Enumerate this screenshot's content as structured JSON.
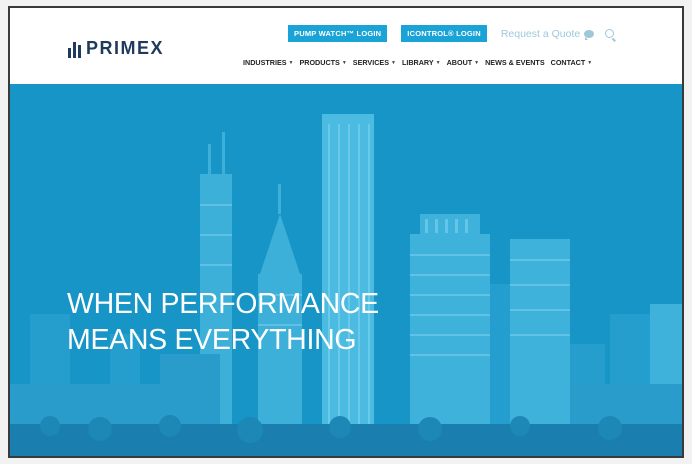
{
  "brand": {
    "name": "PRIMEX"
  },
  "header": {
    "pump_watch_login": "PUMP WATCH™ LOGIN",
    "icontrol_login": "ICONTROL® LOGIN",
    "request_quote": "Request a Quote",
    "nav": [
      {
        "label": "INDUSTRIES",
        "has_dropdown": true
      },
      {
        "label": "PRODUCTS",
        "has_dropdown": true
      },
      {
        "label": "SERVICES",
        "has_dropdown": true
      },
      {
        "label": "LIBRARY",
        "has_dropdown": true
      },
      {
        "label": "ABOUT",
        "has_dropdown": true
      },
      {
        "label": "NEWS & EVENTS",
        "has_dropdown": false
      },
      {
        "label": "CONTACT",
        "has_dropdown": true
      }
    ]
  },
  "hero": {
    "line1": "WHEN PERFORMANCE",
    "line2": "MEANS EVERYTHING"
  },
  "colors": {
    "accent": "#1aa3d6",
    "brand": "#1f3a5c",
    "hero_overlay": "#1b98c8",
    "quote_text": "#9ec8da"
  },
  "icons": {
    "chat": "chat-bubble-icon",
    "search": "search-icon",
    "dropdown": "caret-down-icon"
  }
}
